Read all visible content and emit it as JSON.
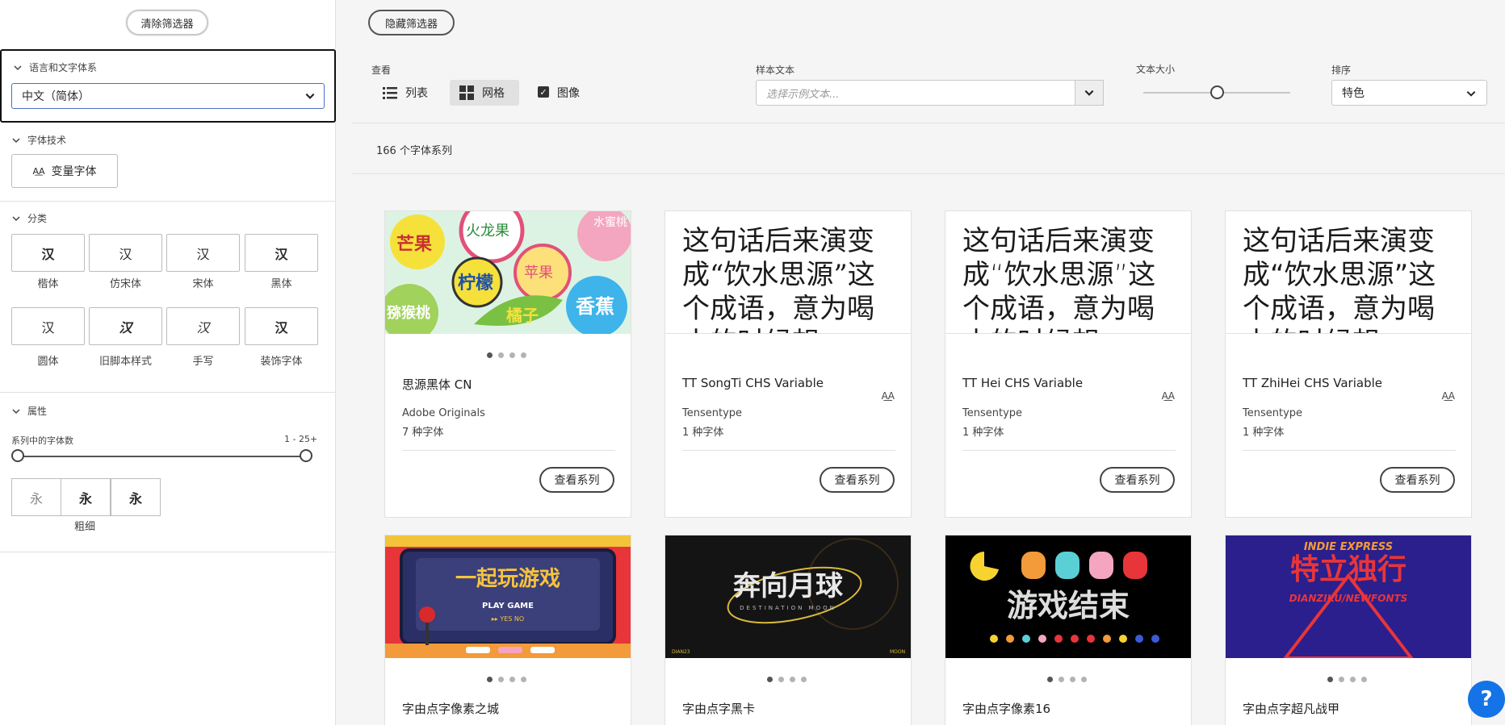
{
  "sidebar": {
    "clear_filters": "清除筛选器",
    "language": {
      "heading": "语言和文字体系",
      "selected": "中文（简体）"
    },
    "technology": {
      "heading": "字体技术",
      "variable_label": "变量字体"
    },
    "classification": {
      "heading": "分类",
      "items": [
        {
          "glyph": "汉",
          "label": "楷体"
        },
        {
          "glyph": "汉",
          "label": "仿宋体"
        },
        {
          "glyph": "汉",
          "label": "宋体"
        },
        {
          "glyph": "汉",
          "label": "黑体"
        },
        {
          "glyph": "汉",
          "label": "圆体"
        },
        {
          "glyph": "汉",
          "label": "旧脚本样式"
        },
        {
          "glyph": "汉",
          "label": "手写"
        },
        {
          "glyph": "汉",
          "label": "装饰字体"
        }
      ]
    },
    "properties": {
      "heading": "属性",
      "range_label": "系列中的字体数",
      "range_value": "1 - 25+",
      "weights": [
        "永",
        "永",
        "永"
      ],
      "weight_label": "粗细"
    }
  },
  "toolbar": {
    "hide_filters": "隐藏筛选器",
    "view_label": "查看",
    "list_label": "列表",
    "grid_label": "网格",
    "images_label": "图像",
    "images_checked": true,
    "sample_label": "样本文本",
    "sample_placeholder": "选择示例文本...",
    "size_label": "文本大小",
    "size_value": 0.5,
    "sort_label": "排序",
    "sort_value": "特色"
  },
  "results": {
    "count": "166 个字体系列"
  },
  "cards": [
    {
      "name": "思源黑体 CN",
      "foundry": "Adobe Originals",
      "fonts": "7 种字体",
      "button": "查看系列",
      "variable": false
    },
    {
      "name": "TT SongTi CHS Variable",
      "foundry": "Tensentype",
      "fonts": "1 种字体",
      "button": "查看系列",
      "variable": true,
      "sample": "这句话后来演变成“饮水思源”这个成语，意为喝水的时候想"
    },
    {
      "name": "TT Hei CHS Variable",
      "foundry": "Tensentype",
      "fonts": "1 种字体",
      "button": "查看系列",
      "variable": true,
      "sample": "这句话后来演变成“饮水思源”这个成语，意为喝水的时候想"
    },
    {
      "name": "TT ZhiHei CHS Variable",
      "foundry": "Tensentype",
      "fonts": "1 种字体",
      "button": "查看系列",
      "variable": true,
      "sample": "这句话后来演变成“饮水思源”这个成语，意为喝水的时候想"
    },
    {
      "name": "字由点字像素之城"
    },
    {
      "name": "字由点字黑卡"
    },
    {
      "name": "字由点字像素16"
    },
    {
      "name": "字由点字超凡战甲"
    }
  ],
  "previews": {
    "fruit": [
      "芒果",
      "火龙果",
      "水蜜桃",
      "柠檬",
      "苹果",
      "猕猴桃",
      "橘子",
      "香蕉"
    ],
    "game": {
      "title": "一起玩游戏",
      "sub": "PLAY GAME",
      "opts": "▸▸ YES   NO"
    },
    "moon": {
      "title": "奔向月球",
      "sub": "DESTINATION MOON",
      "left": "DIAN23",
      "right": "MOON"
    },
    "pixel": {
      "title": "游戏结束"
    },
    "indie": {
      "top": "INDIE EXPRESS",
      "title": "特立独行",
      "bottom": "DIANZIKU/NEWFONTS"
    }
  },
  "help": "?",
  "colors": {
    "accent": "#1473e6"
  }
}
